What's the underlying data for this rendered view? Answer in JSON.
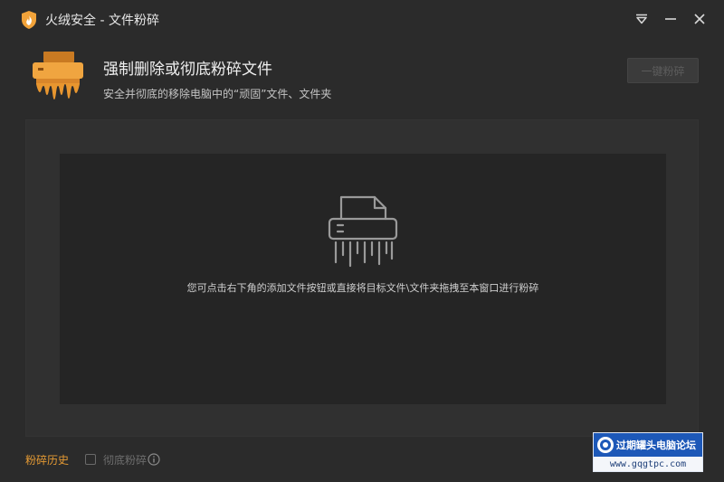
{
  "window": {
    "title": "火绒安全 - 文件粉碎"
  },
  "header": {
    "title": "强制删除或彻底粉碎文件",
    "subtitle": "安全并彻底的移除电脑中的“顽固”文件、文件夹",
    "primary_button": "一键粉碎"
  },
  "drop_zone": {
    "hint": "您可点击右下角的添加文件按钮或直接将目标文件\\文件夹拖拽至本窗口进行粉碎"
  },
  "footer": {
    "history_link": "粉碎历史",
    "checkbox_label": "彻底粉碎",
    "checkbox_checked": false
  },
  "watermark": {
    "title": "过期罐头电脑论坛",
    "url": "www.gqgtpc.com"
  },
  "colors": {
    "accent": "#e69b34",
    "background": "#2b2b2b",
    "panel": "#303030",
    "drop_zone": "#252525"
  },
  "icons": {
    "app": "shield-flame-icon",
    "menu": "dropdown-menu-icon",
    "minimize": "minimize-icon",
    "close": "close-icon",
    "header": "shredder-icon",
    "drop": "shredder-outline-icon",
    "info": "info-icon"
  }
}
